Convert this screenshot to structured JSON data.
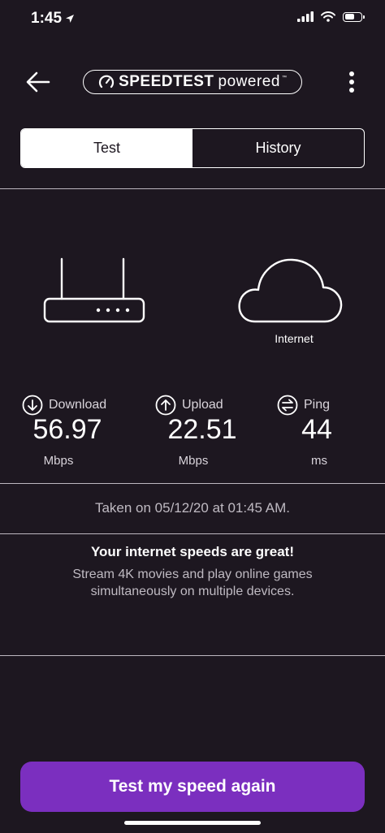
{
  "status_bar": {
    "time": "1:45",
    "battery_level": 0.6
  },
  "header": {
    "brand_name": "SPEEDTEST",
    "brand_suffix": "powered",
    "trademark": "™",
    "icons": {
      "back": "arrow-left-icon",
      "menu": "vertical-ellipsis-icon",
      "brand_logo": "speedometer-icon"
    }
  },
  "tabs": [
    {
      "label": "Test",
      "active": true
    },
    {
      "label": "History",
      "active": false
    }
  ],
  "diagram": {
    "device_icon": "router-icon",
    "server_icon": "cloud-icon",
    "server_label": "Internet"
  },
  "metrics": [
    {
      "label": "Download",
      "value": "56.97",
      "unit": "Mbps",
      "icon": "arrow-down-circle-icon"
    },
    {
      "label": "Upload",
      "value": "22.51",
      "unit": "Mbps",
      "icon": "arrow-up-circle-icon"
    },
    {
      "label": "Ping",
      "value": "44",
      "unit": "ms",
      "icon": "swap-arrows-circle-icon"
    }
  ],
  "result": {
    "taken_text": "Taken on 05/12/20 at 01:45 AM.",
    "verdict_title": "Your internet speeds are great!",
    "verdict_desc": "Stream 4K movies and play online games simultaneously on multiple devices."
  },
  "cta": {
    "label": "Test my speed again"
  },
  "colors": {
    "background": "#1d1720",
    "accent": "#7b2fbf",
    "text_primary": "#ffffff",
    "text_secondary": "#bfbac2"
  }
}
